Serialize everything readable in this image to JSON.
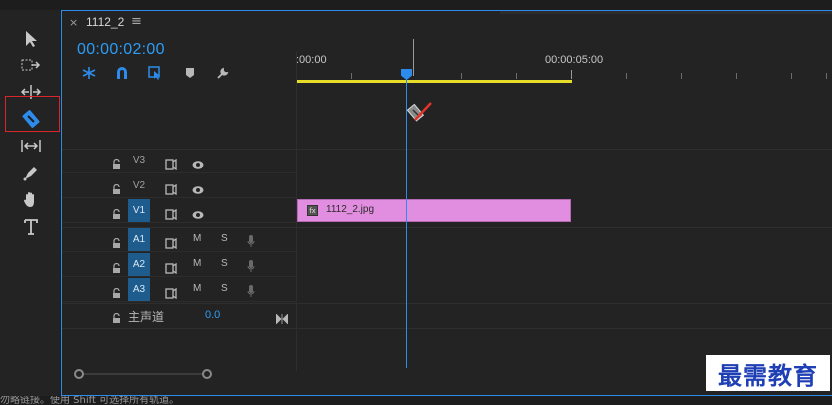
{
  "tab": {
    "title": "1112_2",
    "close": "×",
    "menu": "≡"
  },
  "timecode": "00:00:02:00",
  "ruler": {
    "labels": [
      ":00:00",
      "00:00:05:00"
    ]
  },
  "controls": [
    "snap-insert-icon",
    "magnet-icon",
    "linked-select-icon",
    "marker-icon",
    "wrench-icon"
  ],
  "tools": [
    "selection-tool",
    "track-select-tool",
    "ripple-edit-tool",
    "razor-tool",
    "slip-tool",
    "pen-tool",
    "hand-tool",
    "type-tool"
  ],
  "tracks": {
    "video": [
      {
        "name": "V3",
        "active": false
      },
      {
        "name": "V2",
        "active": false
      },
      {
        "name": "V1",
        "active": true
      }
    ],
    "audio": [
      {
        "name": "A1",
        "m": "M",
        "s": "S"
      },
      {
        "name": "A2",
        "m": "M",
        "s": "S"
      },
      {
        "name": "A3",
        "m": "M",
        "s": "S"
      }
    ],
    "master": {
      "label": "主声道",
      "value": "0.0"
    }
  },
  "clip": {
    "name": "1112_2.jpg",
    "fx": "fx"
  },
  "status": "勿略链接。使用 Shift 可选择所有轨道。",
  "watermark": "最需教育",
  "colors": {
    "accent": "#2d8ceb",
    "clip": "#e28ee0",
    "workbar": "#e6dc2a",
    "highlight": "#d8262a"
  }
}
